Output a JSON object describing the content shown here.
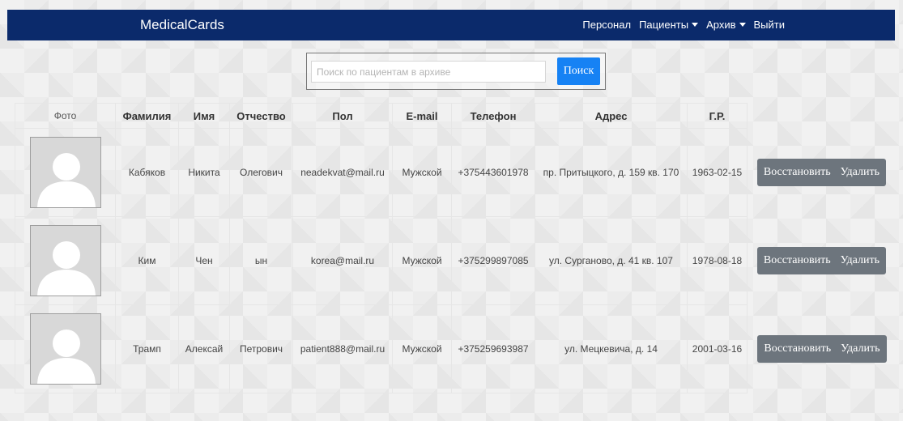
{
  "navbar": {
    "brand": "MedicalCards",
    "items": [
      {
        "label": "Персонал",
        "dropdown": false
      },
      {
        "label": "Пациенты",
        "dropdown": true
      },
      {
        "label": "Архив",
        "dropdown": true
      },
      {
        "label": "Выйти",
        "dropdown": false
      }
    ]
  },
  "search": {
    "placeholder": "Поиск по пациентам в архиве",
    "value": "",
    "button_label": "Поиск"
  },
  "table": {
    "headers": [
      "Фото",
      "Фамилия",
      "Имя",
      "Отчество",
      "Пол",
      "E-mail",
      "Телефон",
      "Адрес",
      "Г.Р."
    ],
    "rows": [
      {
        "surname": "Кабяков",
        "name": "Никита",
        "patronymic": "Олегович",
        "email": "neadekvat@mail.ru",
        "sex": "Мужской",
        "phone": "+375443601978",
        "address": "пр. Притыцкого, д. 159 кв. 170",
        "birth_date": "1963-02-15",
        "restore_label": "Восстановить",
        "delete_label": "Удалить"
      },
      {
        "surname": "Ким",
        "name": "Чен",
        "patronymic": "ын",
        "email": "korea@mail.ru",
        "sex": "Мужской",
        "phone": "+375299897085",
        "address": "ул. Сурганово, д. 41 кв. 107",
        "birth_date": "1978-08-18",
        "restore_label": "Восстановить",
        "delete_label": "Удалить"
      },
      {
        "surname": "Трамп",
        "name": "Алексай",
        "patronymic": "Петрович",
        "email": "patient888@mail.ru",
        "sex": "Мужской",
        "phone": "+375259693987",
        "address": "ул. Мецкевича, д. 14",
        "birth_date": "2001-03-16",
        "restore_label": "Восстановить",
        "delete_label": "Удалить"
      }
    ]
  },
  "colors": {
    "navbar_bg": "#0b2a6b",
    "search_button": "#1682f4",
    "action_button": "#6d757d"
  },
  "icons": {
    "avatar": "person-silhouette-icon",
    "dropdown": "caret-down-icon"
  }
}
